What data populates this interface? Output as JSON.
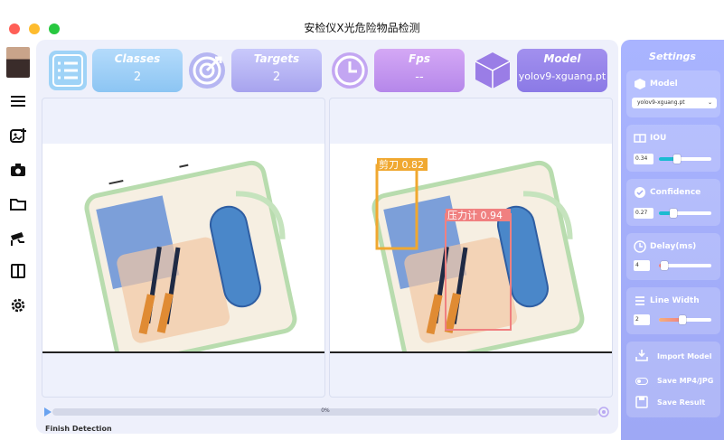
{
  "window": {
    "title": "安检仪X光危险物品检测"
  },
  "cards": {
    "classes": {
      "label": "Classes",
      "value": "2"
    },
    "targets": {
      "label": "Targets",
      "value": "2"
    },
    "fps": {
      "label": "Fps",
      "value": "--"
    },
    "model": {
      "label": "Model",
      "value": "yolov9-xguang.pt"
    }
  },
  "detections": [
    {
      "label": "剪刀 0.82",
      "color": "#f0a830"
    },
    {
      "label": "压力计 0.94",
      "color": "#f08080"
    }
  ],
  "progress": {
    "text": "0%",
    "value": 0
  },
  "status": "Finish Detection",
  "settings": {
    "title": "Settings",
    "model": {
      "label": "Model",
      "selected": "yolov9-xguang.pt"
    },
    "iou": {
      "label": "IOU",
      "value": "0.34",
      "level": 0.34
    },
    "confidence": {
      "label": "Confidence",
      "value": "0.27",
      "level": 0.27
    },
    "delay": {
      "label": "Delay(ms)",
      "value": "4",
      "level": 0.08
    },
    "line_width": {
      "label": "Line Width",
      "value": "2",
      "level": 0.45
    },
    "import_model": "Import Model",
    "save_mp4": "Save MP4/JPG",
    "save_result": "Save Result"
  }
}
